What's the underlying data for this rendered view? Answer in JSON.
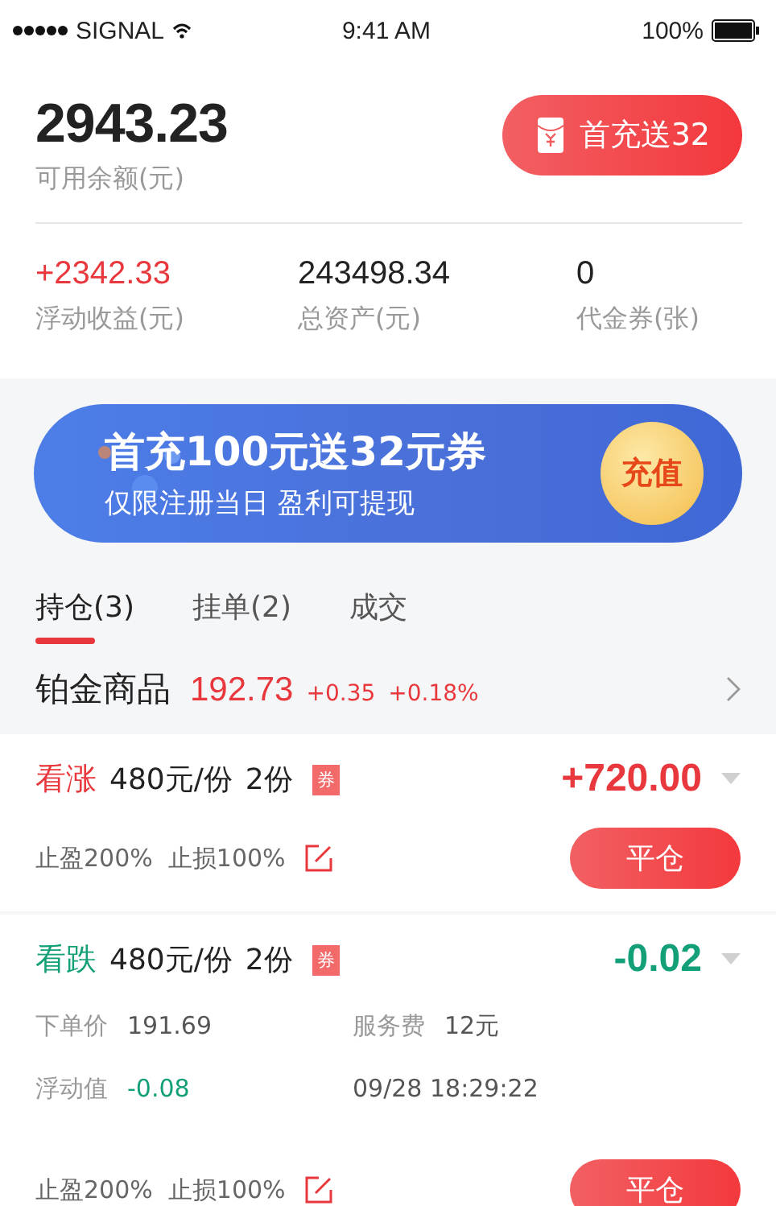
{
  "status_bar": {
    "carrier": "SIGNAL",
    "time": "9:41 AM",
    "battery": "100%"
  },
  "account": {
    "balance": "2943.23",
    "balance_label": "可用余额(元)",
    "promo_button": "首充送32",
    "stats": [
      {
        "value": "+2342.33",
        "label": "浮动收益(元)",
        "kind": "gain"
      },
      {
        "value": "243498.34",
        "label": "总资产(元)",
        "kind": "plain"
      },
      {
        "value": "0",
        "label": "代金券(张)",
        "kind": "plain"
      }
    ]
  },
  "banner": {
    "title": "首充100元送32元券",
    "subtitle": "仅限注册当日  盈利可提现",
    "button": "充值"
  },
  "tabs": [
    {
      "label": "持仓(3)",
      "selected": true
    },
    {
      "label": "挂单(2)",
      "selected": false
    },
    {
      "label": "成交",
      "selected": false
    }
  ],
  "product": {
    "name": "铂金商品",
    "price": "192.73",
    "change": "+0.35",
    "change_pct": "+0.18%"
  },
  "positions": [
    {
      "direction": "看涨",
      "kind": "long",
      "price": "480元/份",
      "quantity": "2份",
      "coupon": "券",
      "profit": "+720.00",
      "stop_line": "止盈200%  止损100%",
      "close_button": "平仓"
    },
    {
      "direction": "看跌",
      "kind": "short",
      "price": "480元/份",
      "quantity": "2份",
      "coupon": "券",
      "profit": "-0.02",
      "details": [
        {
          "label": "下单价",
          "value": "191.69",
          "kind": "plain"
        },
        {
          "label": "服务费",
          "value": "12元",
          "kind": "plain"
        },
        {
          "label": "浮动值",
          "value": "-0.08",
          "kind": "loss"
        },
        {
          "value": "09/28 18:29:22",
          "kind": "plain"
        }
      ],
      "stop_line": "止盈200%  止损100%",
      "close_button": "平仓"
    }
  ]
}
